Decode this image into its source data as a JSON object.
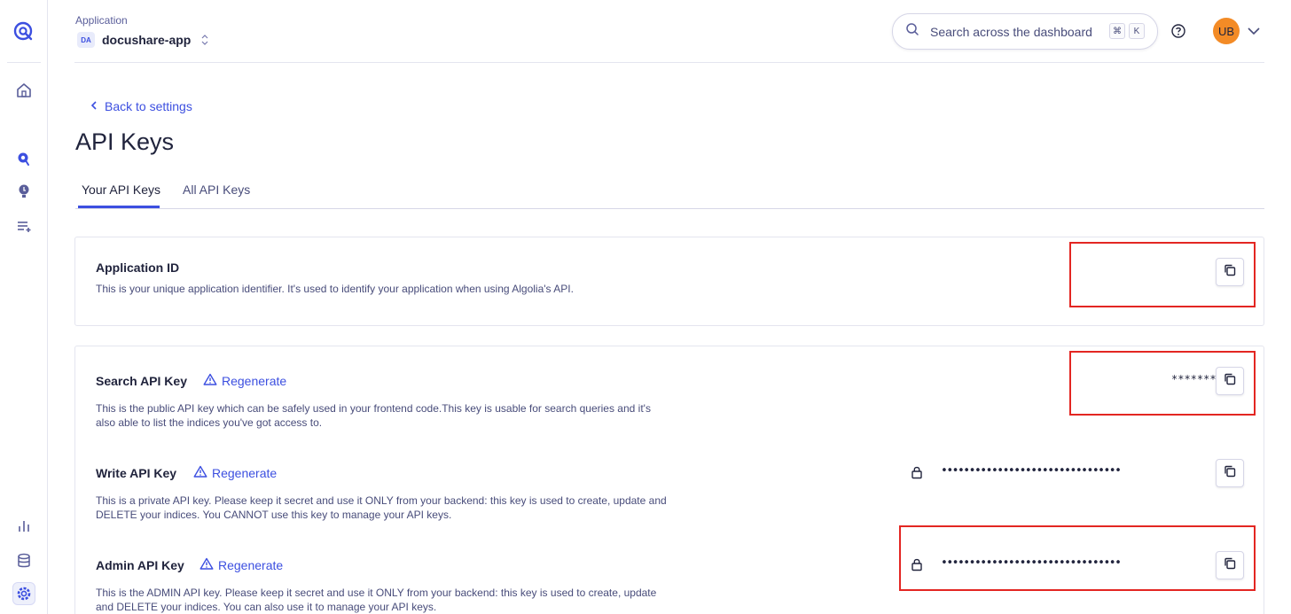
{
  "header": {
    "app_label": "Application",
    "app_badge": "DA",
    "app_name": "docushare-app",
    "search_placeholder": "Search across the dashboard",
    "shortcut_cmd": "⌘",
    "shortcut_key": "K",
    "avatar_initials": "UB"
  },
  "page": {
    "back_label": "Back to settings",
    "title": "API Keys"
  },
  "tabs": [
    {
      "label": "Your API Keys",
      "active": true
    },
    {
      "label": "All API Keys",
      "active": false
    }
  ],
  "application_id": {
    "title": "Application ID",
    "description": "This is your unique application identifier. It's used to identify your application when using Algolia's API."
  },
  "keys": [
    {
      "title": "Search API Key",
      "regenerate": "Regenerate",
      "description": "This is the public API key which can be safely used in your frontend code.This key is usable for search queries and it's also able to list the indices you've got access to.",
      "masked": "********"
    },
    {
      "title": "Write API Key",
      "regenerate": "Regenerate",
      "description": "This is a private API key. Please keep it secret and use it ONLY from your backend: this key is used to create, update and DELETE your indices. You CANNOT use this key to manage your API keys.",
      "masked": "••••••••••••••••••••••••••••••••"
    },
    {
      "title": "Admin API Key",
      "regenerate": "Regenerate",
      "description": "This is the ADMIN API key. Please keep it secret and use it ONLY from your backend: this key is used to create, update and DELETE your indices. You can also use it to manage your API keys.",
      "masked": "••••••••••••••••••••••••••••••••"
    }
  ],
  "colors": {
    "accent": "#3c4fe0",
    "avatar": "#f38b26",
    "highlight_box": "#e32622"
  },
  "icons": [
    "algolia-logo-icon",
    "home-icon",
    "search-pin-icon",
    "bulb-icon",
    "list-add-icon",
    "analytics-icon",
    "database-icon",
    "settings-gear-icon",
    "search-icon",
    "help-icon",
    "chevron-down-icon",
    "chevron-left-icon",
    "warning-triangle-icon",
    "lock-icon",
    "copy-icon"
  ]
}
